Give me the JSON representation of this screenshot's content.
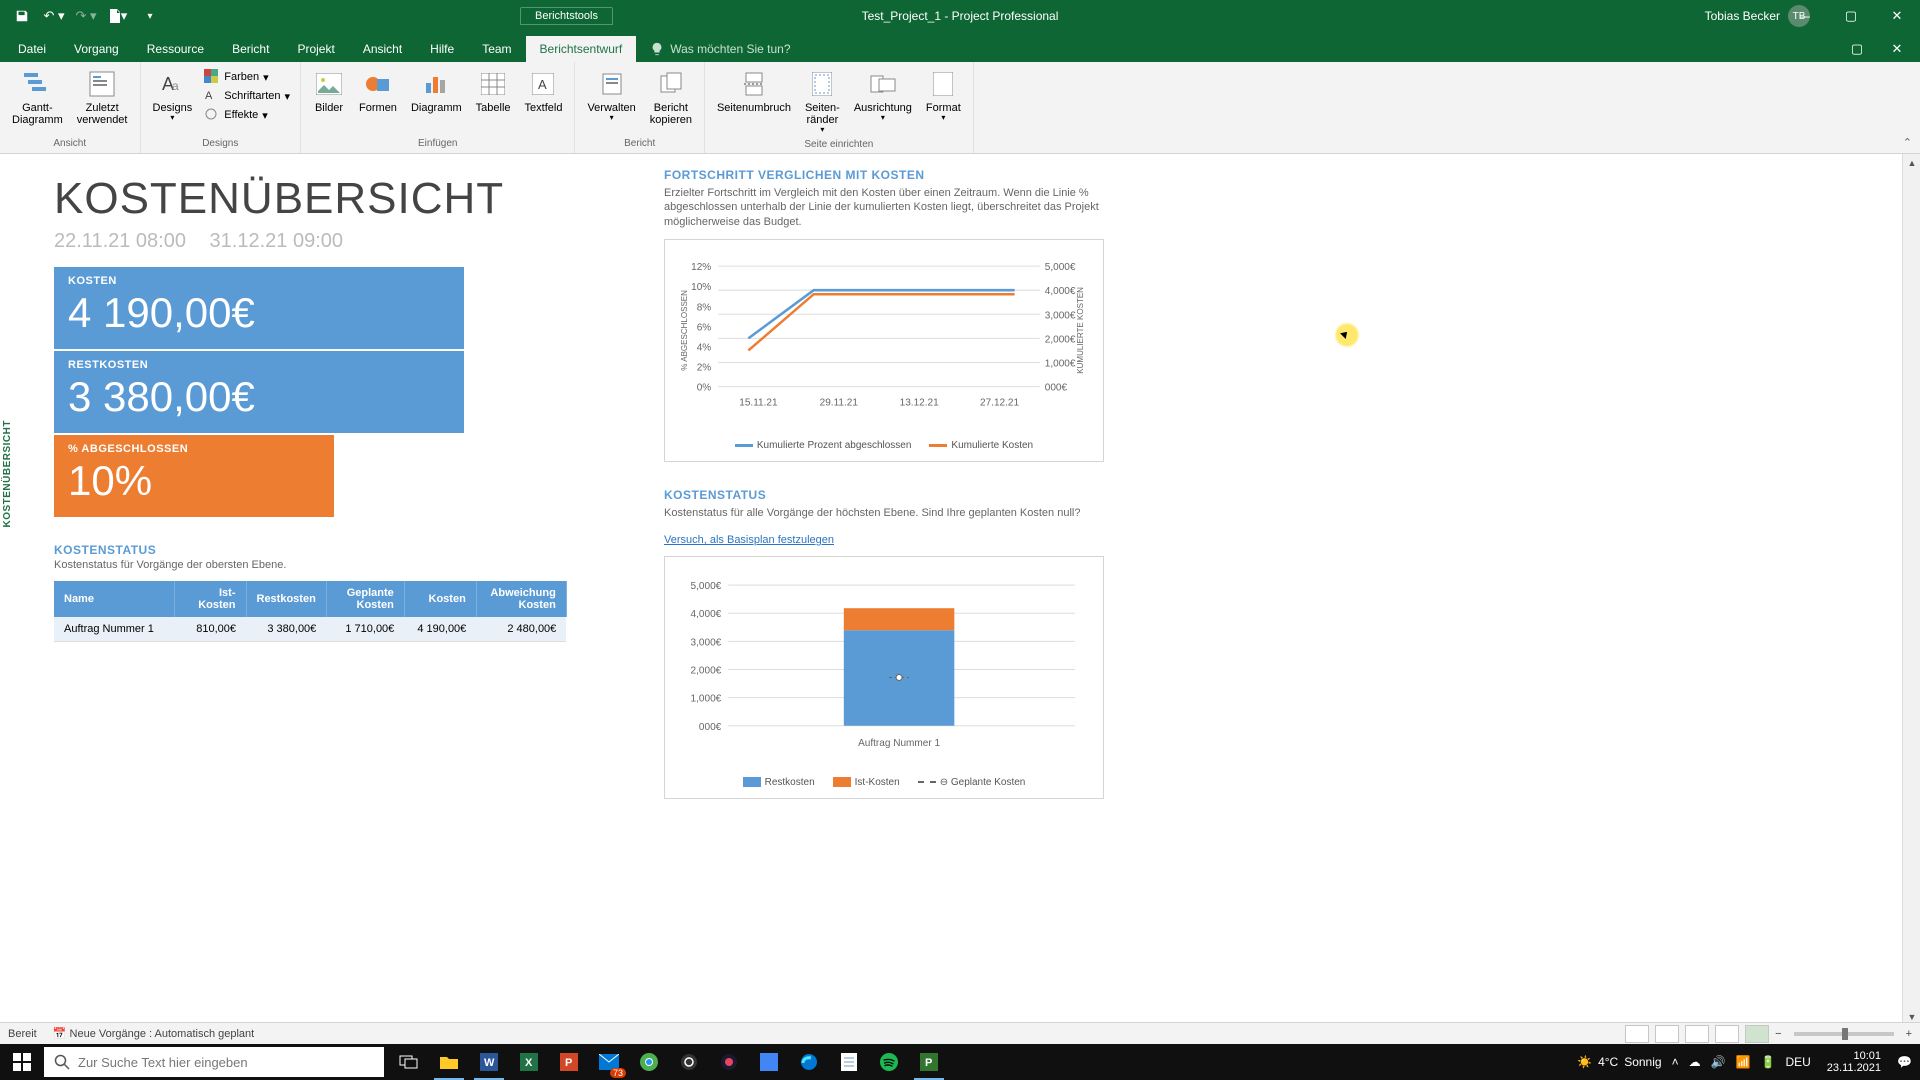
{
  "titlebar": {
    "context_tab": "Berichtstools",
    "doc_title": "Test_Project_1  -  Project Professional",
    "user": "Tobias Becker",
    "initials": "TB"
  },
  "tabs": [
    "Datei",
    "Vorgang",
    "Ressource",
    "Bericht",
    "Projekt",
    "Ansicht",
    "Hilfe",
    "Team",
    "Berichtsentwurf"
  ],
  "active_tab_idx": 8,
  "tellme": "Was möchten Sie tun?",
  "ribbon": {
    "ansicht": {
      "gantt": "Gantt-\nDiagramm",
      "recent": "Zuletzt\nverwendet",
      "name": "Ansicht"
    },
    "designs": {
      "designs": "Designs",
      "colors": "Farben",
      "fonts": "Schriftarten",
      "effects": "Effekte",
      "name": "Designs"
    },
    "insert": {
      "images": "Bilder",
      "shapes": "Formen",
      "chart": "Diagramm",
      "table": "Tabelle",
      "textbox": "Textfeld",
      "name": "Einfügen"
    },
    "report": {
      "manage": "Verwalten",
      "copy": "Bericht\nkopieren",
      "name": "Bericht"
    },
    "page": {
      "break": "Seitenumbruch",
      "margins": "Seiten-\nränder",
      "orient": "Ausrichtung",
      "format": "Format",
      "name": "Seite einrichten"
    }
  },
  "report": {
    "title": "KOSTENÜBERSICHT",
    "date_from": "22.11.21 08:00",
    "date_to": "31.12.21 09:00",
    "vtab": "KOSTENÜBERSICHT",
    "kpi": {
      "cost_label": "KOSTEN",
      "cost_val": "4 190,00€",
      "remain_label": "RESTKOSTEN",
      "remain_val": "3 380,00€",
      "pct_label": "% ABGESCHLOSSEN",
      "pct_val": "10%"
    },
    "table": {
      "title": "KOSTENSTATUS",
      "sub": "Kostenstatus für Vorgänge der obersten Ebene.",
      "headers": [
        "Name",
        "Ist-Kosten",
        "Restkosten",
        "Geplante Kosten",
        "Kosten",
        "Abweichung Kosten"
      ],
      "rows": [
        [
          "Auftrag Nummer 1",
          "810,00€",
          "3 380,00€",
          "1 710,00€",
          "4 190,00€",
          "2 480,00€"
        ]
      ]
    },
    "chart1": {
      "title": "FORTSCHRITT VERGLICHEN MIT KOSTEN",
      "desc": "Erzielter Fortschritt im Vergleich mit den Kosten über einen Zeitraum. Wenn die Linie % abgeschlossen unterhalb der Linie der kumulierten Kosten liegt, überschreitet das Projekt möglicherweise das Budget.",
      "legend": [
        "Kumulierte Prozent abgeschlossen",
        "Kumulierte Kosten"
      ],
      "y1_label": "% ABGESCHLOSSEN",
      "y2_label": "KUMULIERTE KOSTEN"
    },
    "chart2": {
      "title": "KOSTENSTATUS",
      "desc": "Kostenstatus für alle Vorgänge der höchsten Ebene. Sind Ihre geplanten Kosten null?",
      "link": "Versuch, als Basisplan festzulegen",
      "legend": [
        "Restkosten",
        "Ist-Kosten",
        "Geplante Kosten"
      ],
      "xcat": "Auftrag Nummer 1"
    }
  },
  "chart_data": [
    {
      "type": "line",
      "title": "FORTSCHRITT VERGLICHEN MIT KOSTEN",
      "x": [
        "15.11.21",
        "29.11.21",
        "13.12.21",
        "27.12.21"
      ],
      "series": [
        {
          "name": "Kumulierte Prozent abgeschlossen",
          "axis": "left",
          "values": [
            5,
            10,
            10,
            10
          ]
        },
        {
          "name": "Kumulierte Kosten",
          "axis": "right",
          "values": [
            2100,
            4190,
            4190,
            4190
          ]
        }
      ],
      "y_left": {
        "label": "% ABGESCHLOSSEN",
        "ticks": [
          0,
          2,
          4,
          6,
          8,
          10,
          12
        ]
      },
      "y_right": {
        "label": "KUMULIERTE KOSTEN",
        "ticks": [
          "000€",
          "1,000€",
          "2,000€",
          "3,000€",
          "4,000€",
          "5,000€"
        ]
      }
    },
    {
      "type": "bar",
      "title": "KOSTENSTATUS",
      "categories": [
        "Auftrag Nummer 1"
      ],
      "stack_series": [
        {
          "name": "Restkosten",
          "values": [
            3380
          ]
        },
        {
          "name": "Ist-Kosten",
          "values": [
            810
          ]
        }
      ],
      "marker_series": {
        "name": "Geplante Kosten",
        "values": [
          1710
        ]
      },
      "y_ticks": [
        "000€",
        "1,000€",
        "2,000€",
        "3,000€",
        "4,000€",
        "5,000€"
      ],
      "ylim": [
        0,
        5000
      ]
    }
  ],
  "status": {
    "ready": "Bereit",
    "sched": "Neue Vorgänge : Automatisch geplant"
  },
  "taskbar": {
    "search_placeholder": "Zur Suche Text hier eingeben",
    "weather_temp": "4°C",
    "weather_cond": "Sonnig",
    "lang": "DEU",
    "time": "10:01",
    "date": "23.11.2021",
    "mail_badge": "73"
  }
}
